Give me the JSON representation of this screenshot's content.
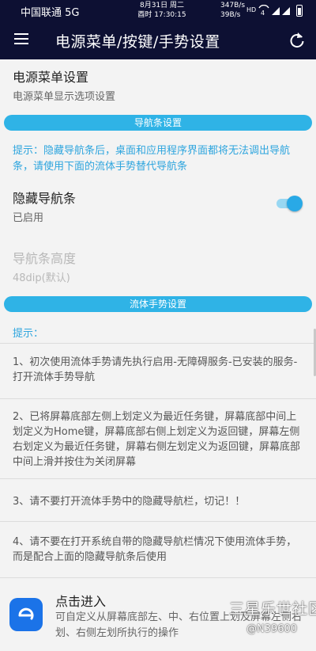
{
  "status_bar": {
    "carrier": "中国联通 5G",
    "date_line1": "8月31日 周二",
    "date_line2": "酉时 17:30:15",
    "net_up": "347B/s",
    "net_down": "39B/s",
    "hd": "HD"
  },
  "app_bar": {
    "title": "电源菜单/按键/手势设置"
  },
  "power_menu": {
    "title": "电源菜单设置",
    "summary": "电源菜单显示选项设置"
  },
  "nav_section": {
    "header": "导航条设置",
    "hint": "提示：隐藏导航条后，桌面和应用程序界面都将无法调出导航条，请使用下面的流体手势替代导航条",
    "hide_nav": {
      "title": "隐藏导航条",
      "summary": "已启用",
      "enabled": true
    },
    "nav_height": {
      "title": "导航条高度",
      "summary": "48dip(默认)"
    }
  },
  "gesture_section": {
    "header": "流体手势设置",
    "hint_label": "提示：",
    "notes": [
      "1、初次使用流体手势请先执行启用-无障碍服务-已安装的服务-打开流体手势导航",
      "2、已将屏幕底部左侧上划定义为最近任务键，屏幕底部中间上划定义为Home键，屏幕底部右侧上划定义为返回键，屏幕左侧右划定义为最近任务键，屏幕右侧左划定义为返回键，屏幕底部中间上滑并按住为关闭屏幕",
      "3、请不要打开流体手势中的隐藏导航栏，切记！！",
      "4、请不要在打开系统自带的隐藏导航栏情况下使用流体手势，而是配合上面的隐藏导航条后使用"
    ],
    "entry": {
      "title": "点击进入",
      "summary": "可自定义从屏幕底部左、中、右位置上划及屏幕左侧右划、右侧左划所执行的操作"
    }
  },
  "watermark": {
    "brand": "三星乐世社区",
    "user": "@N39600"
  },
  "colors": {
    "app_bar": "#0d1033",
    "accent": "#2fb3e6",
    "hint_text": "#2ea5de",
    "entry_icon": "#1b73e8"
  }
}
